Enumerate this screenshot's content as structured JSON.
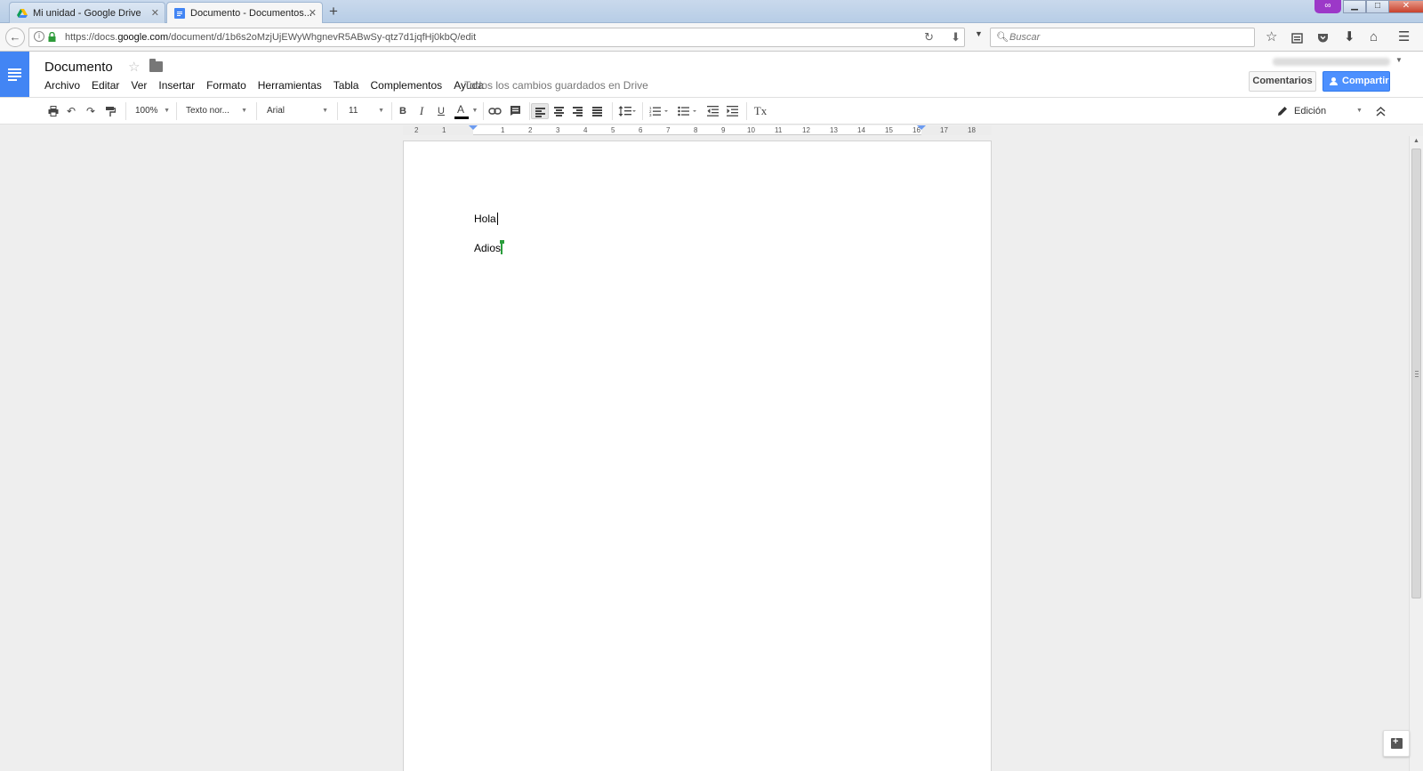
{
  "browser": {
    "tabs": [
      {
        "title": "Mi unidad - Google Drive",
        "icon": "google-drive-icon",
        "active": false
      },
      {
        "title": "Documento - Documentos...",
        "icon": "google-docs-icon",
        "active": true
      }
    ],
    "url": {
      "prefix": "https://docs.",
      "domain": "google.com",
      "path": "/document/d/1b6s2oMzjUjEWyWhgnevR5ABwSy-qtz7d1jqfHj0kbQ/edit"
    },
    "search_placeholder": "Buscar"
  },
  "docs": {
    "title": "Documento",
    "menu": [
      "Archivo",
      "Editar",
      "Ver",
      "Insertar",
      "Formato",
      "Herramientas",
      "Tabla",
      "Complementos",
      "Ayuda"
    ],
    "save_status": "Todos los cambios guardados en Drive",
    "comments_label": "Comentarios",
    "share_label": "Compartir",
    "accent_color": "#4285f4",
    "share_color": "#4d90fe"
  },
  "toolbar": {
    "zoom": "100%",
    "style": "Texto nor...",
    "font": "Arial",
    "font_size": "11",
    "bold": "B",
    "italic": "I",
    "underline": "U",
    "text_color": "A",
    "clear_format": "Tx",
    "mode": "Edición"
  },
  "ruler": {
    "labels": [
      "2",
      "1",
      "1",
      "2",
      "3",
      "4",
      "5",
      "6",
      "7",
      "8",
      "9",
      "10",
      "11",
      "12",
      "13",
      "14",
      "15",
      "16",
      "17",
      "18"
    ]
  },
  "document": {
    "paragraphs": [
      "Hola",
      "Adios"
    ]
  }
}
